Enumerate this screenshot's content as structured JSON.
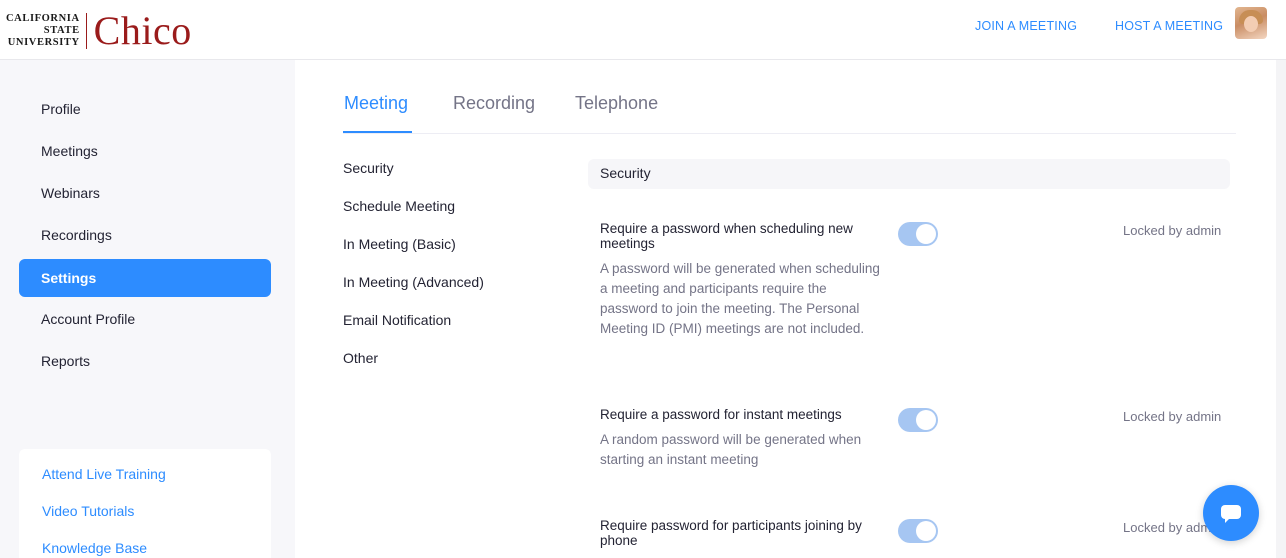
{
  "header": {
    "logo": {
      "line1": "CALIFORNIA",
      "line2": "STATE",
      "line3": "UNIVERSITY",
      "wordmark": "Chico"
    },
    "join_meeting": "JOIN A MEETING",
    "host_meeting": "HOST A MEETING",
    "avatar_icon": "user-avatar"
  },
  "sidebar": {
    "items": [
      {
        "label": "Profile"
      },
      {
        "label": "Meetings"
      },
      {
        "label": "Webinars"
      },
      {
        "label": "Recordings"
      },
      {
        "label": "Settings",
        "active": true
      },
      {
        "label": "Account Profile"
      },
      {
        "label": "Reports"
      }
    ],
    "help": [
      {
        "label": "Attend Live Training"
      },
      {
        "label": "Video Tutorials"
      },
      {
        "label": "Knowledge Base"
      }
    ]
  },
  "tabs": [
    {
      "label": "Meeting",
      "active": true
    },
    {
      "label": "Recording"
    },
    {
      "label": "Telephone"
    }
  ],
  "subnav": [
    {
      "label": "Security"
    },
    {
      "label": "Schedule Meeting"
    },
    {
      "label": "In Meeting (Basic)"
    },
    {
      "label": "In Meeting (Advanced)"
    },
    {
      "label": "Email Notification"
    },
    {
      "label": "Other"
    }
  ],
  "section": {
    "title": "Security",
    "settings": [
      {
        "title": "Require a password when scheduling new meetings",
        "description": "A password will be generated when scheduling a meeting and participants require the password to join the meeting. The Personal Meeting ID (PMI) meetings are not included.",
        "enabled": true,
        "locked": "Locked by admin"
      },
      {
        "title": "Require a password for instant meetings",
        "description": "A random password will be generated when starting an instant meeting",
        "enabled": true,
        "locked": "Locked by admin"
      },
      {
        "title": "Require password for participants joining by phone",
        "description": "",
        "enabled": true,
        "locked": "Locked by admin"
      }
    ]
  },
  "colors": {
    "accent": "#2d8cff",
    "brand": "#9a1b1b",
    "toggle_on": "#a6c6f2"
  },
  "chat": {
    "icon": "chat-bubble-icon"
  }
}
